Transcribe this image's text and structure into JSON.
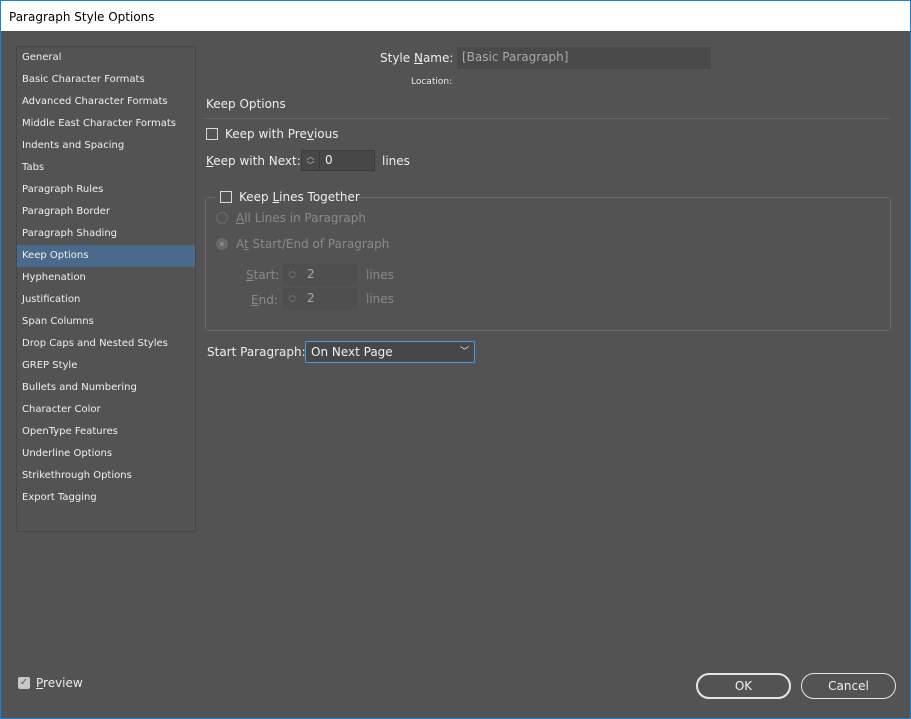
{
  "window": {
    "title": "Paragraph Style Options"
  },
  "sidebar": {
    "items": [
      "General",
      "Basic Character Formats",
      "Advanced Character Formats",
      "Middle East Character Formats",
      "Indents and Spacing",
      "Tabs",
      "Paragraph Rules",
      "Paragraph Border",
      "Paragraph Shading",
      "Keep Options",
      "Hyphenation",
      "Justification",
      "Span Columns",
      "Drop Caps and Nested Styles",
      "GREP Style",
      "Bullets and Numbering",
      "Character Color",
      "OpenType Features",
      "Underline Options",
      "Strikethrough Options",
      "Export Tagging"
    ],
    "selected": "Keep Options"
  },
  "header": {
    "style_name_label": "Style Name:",
    "style_name_value": "[Basic Paragraph]",
    "location_label": "Location:"
  },
  "section": {
    "title": "Keep Options"
  },
  "keep": {
    "with_previous_label": "Keep with Previous",
    "with_previous_checked": false,
    "with_next_label": "Keep with Next:",
    "with_next_value": "0",
    "lines": "lines",
    "lines_together_label": "Keep Lines Together",
    "lines_together_checked": false,
    "all_lines_label": "All Lines in Paragraph",
    "start_end_label": "At Start/End of Paragraph",
    "start_label": "Start:",
    "start_value": "2",
    "end_label": "End:",
    "end_value": "2"
  },
  "start_paragraph": {
    "label": "Start Paragraph:",
    "value": "On Next Page"
  },
  "footer": {
    "preview_label": "Preview",
    "preview_checked": true,
    "ok": "OK",
    "cancel": "Cancel"
  }
}
